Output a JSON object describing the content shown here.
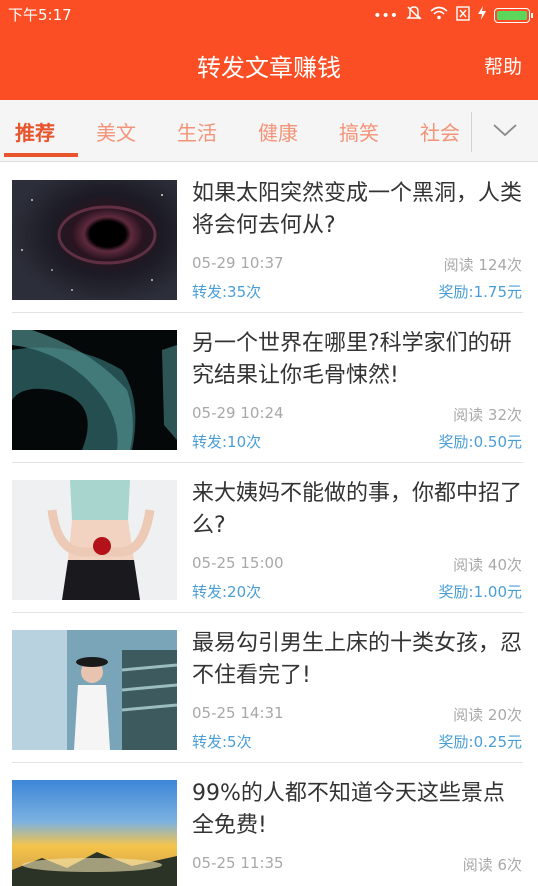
{
  "status_bar": {
    "time": "下午5:17",
    "icons": [
      "more-dots-icon",
      "mute-icon",
      "wifi-icon",
      "sim-icon",
      "charging-icon",
      "battery-icon"
    ]
  },
  "header": {
    "title": "转发文章赚钱",
    "help_label": "帮助"
  },
  "colors": {
    "accent": "#fb4e24",
    "tab_active": "#e8542b",
    "tab_inactive": "#f39478",
    "link_blue": "#4a9ed6",
    "meta_gray": "#a8a8a8"
  },
  "tabs": [
    {
      "label": "推荐"
    },
    {
      "label": "美文"
    },
    {
      "label": "生活"
    },
    {
      "label": "健康"
    },
    {
      "label": "搞笑"
    },
    {
      "label": "社会"
    }
  ],
  "articles": [
    {
      "title": "如果太阳突然变成一个黑洞，人类将会何去何从?",
      "date": "05-29 10:37",
      "reads": "阅读 124次",
      "shares": "转发:35次",
      "reward": "奖励:1.75元"
    },
    {
      "title": "另一个世界在哪里?科学家们的研究结果让你毛骨悚然!",
      "date": "05-29 10:24",
      "reads": "阅读 32次",
      "shares": "转发:10次",
      "reward": "奖励:0.50元"
    },
    {
      "title": "来大姨妈不能做的事，你都中招了么?",
      "date": "05-25 15:00",
      "reads": "阅读 40次",
      "shares": "转发:20次",
      "reward": "奖励:1.00元"
    },
    {
      "title": "最易勾引男生上床的十类女孩，忍不住看完了!",
      "date": "05-25 14:31",
      "reads": "阅读 20次",
      "shares": "转发:5次",
      "reward": "奖励:0.25元"
    },
    {
      "title": "99%的人都不知道今天这些景点全免费!",
      "date": "05-25 11:35",
      "reads": "阅读 6次",
      "shares": "",
      "reward": ""
    }
  ]
}
